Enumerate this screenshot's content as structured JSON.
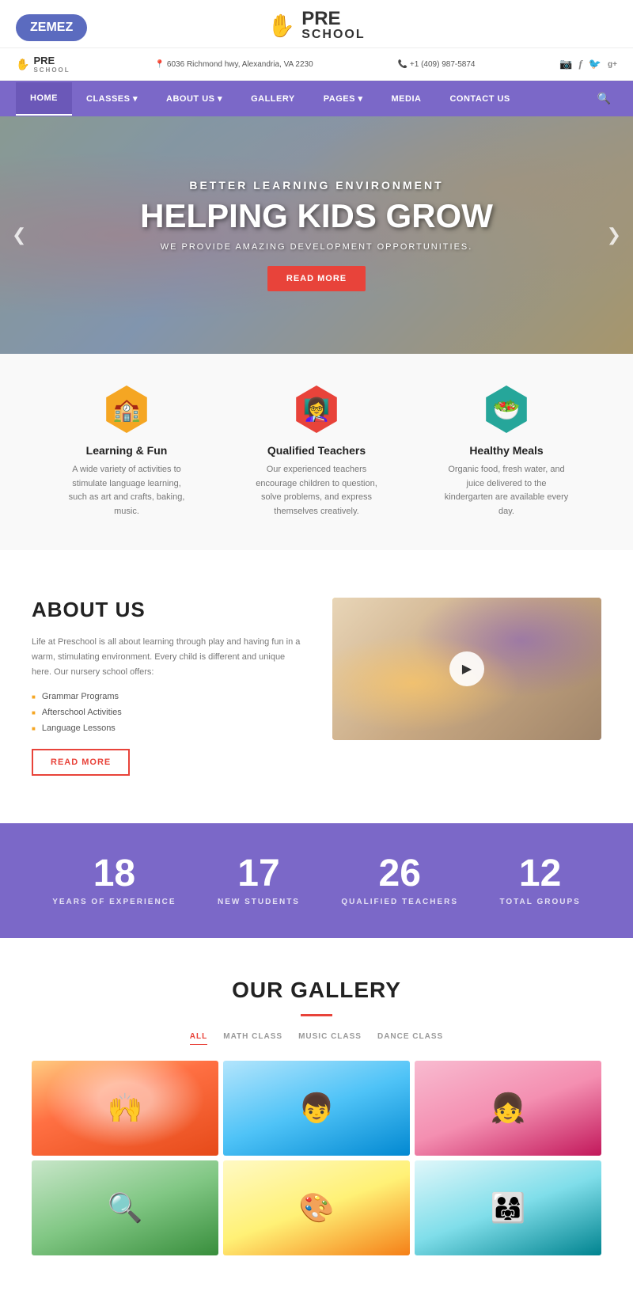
{
  "topbar": {
    "zemez_label": "ZEMEZ",
    "brand_pre": "PRE",
    "brand_school": "SCHOOL",
    "brand_hand": "✋"
  },
  "infobar": {
    "logo_pre": "PRE",
    "logo_school": "SCHOOL",
    "address": "6036 Richmond hwy, Alexandria, VA 2230",
    "phone": "+1 (409) 987-5874",
    "address_icon": "📍",
    "phone_icon": "📞"
  },
  "nav": {
    "items": [
      {
        "label": "HOME",
        "active": true
      },
      {
        "label": "CLASSES ▾",
        "active": false
      },
      {
        "label": "ABOUT US ▾",
        "active": false
      },
      {
        "label": "GALLERY",
        "active": false
      },
      {
        "label": "PAGES ▾",
        "active": false
      },
      {
        "label": "MEDIA",
        "active": false
      },
      {
        "label": "CONTACT US",
        "active": false
      }
    ],
    "search_icon": "🔍"
  },
  "hero": {
    "subtitle": "BETTER LEARNING ENVIRONMENT",
    "title": "HELPING KIDS GROW",
    "description": "WE PROVIDE AMAZING DEVELOPMENT OPPORTUNITIES.",
    "cta_label": "READ MORE",
    "arrow_left": "❮",
    "arrow_right": "❯"
  },
  "features": [
    {
      "icon": "🏫",
      "title": "Learning & Fun",
      "desc": "A wide variety of activities to stimulate language learning, such as art and crafts, baking, music.",
      "color_class": "feature-icon-yellow"
    },
    {
      "icon": "👩‍🏫",
      "title": "Qualified Teachers",
      "desc": "Our experienced teachers encourage children to question, solve problems, and express themselves creatively.",
      "color_class": "feature-icon-red"
    },
    {
      "icon": "🥗",
      "title": "Healthy Meals",
      "desc": "Organic food, fresh water, and juice delivered to the kindergarten are available every day.",
      "color_class": "feature-icon-teal"
    }
  ],
  "about": {
    "title": "ABOUT US",
    "desc": "Life at Preschool is all about learning through play and having fun in a warm, stimulating environment. Every child is different and unique here. Our nursery school offers:",
    "list": [
      "Grammar Programs",
      "Afterschool Activities",
      "Language Lessons"
    ],
    "cta_label": "READ MORE",
    "play_icon": "▶"
  },
  "stats": [
    {
      "number": "18",
      "label": "YEARS OF EXPERIENCE"
    },
    {
      "number": "17",
      "label": "NEW STUDENTS"
    },
    {
      "number": "26",
      "label": "QUALIFIED TEACHERS"
    },
    {
      "number": "12",
      "label": "TOTAL GROUPS"
    }
  ],
  "gallery": {
    "title": "OUR GALLERY",
    "tabs": [
      {
        "label": "ALL",
        "active": true
      },
      {
        "label": "MATH CLASS",
        "active": false
      },
      {
        "label": "MUSIC CLASS",
        "active": false
      },
      {
        "label": "DANCE CLASS",
        "active": false
      }
    ],
    "items": [
      {
        "emoji": "🙌"
      },
      {
        "emoji": "👦"
      },
      {
        "emoji": "👧"
      },
      {
        "emoji": "🔍"
      },
      {
        "emoji": "🎨"
      },
      {
        "emoji": "👨‍👩‍👧"
      }
    ]
  },
  "social": {
    "icons": [
      "📷",
      "f",
      "🐦",
      "g+"
    ]
  }
}
